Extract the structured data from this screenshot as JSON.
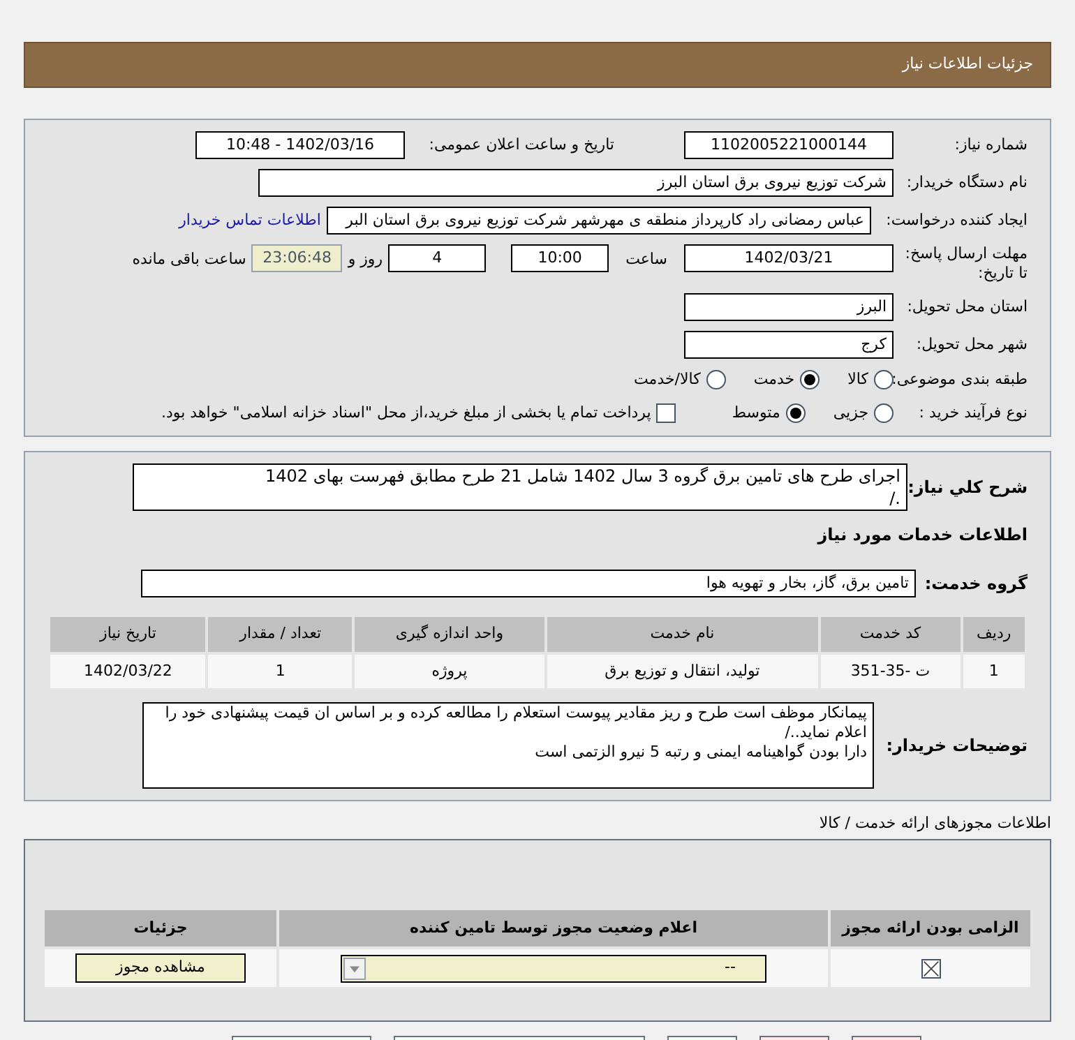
{
  "header": {
    "title": "جزئیات اطلاعات نیاز"
  },
  "need": {
    "number_label": "شماره نیاز:",
    "number": "1102005221000144",
    "announce_label": "تاریخ و ساعت اعلان عمومی:",
    "announce": "1402/03/16 - 10:48",
    "buyer_label": "نام دستگاه خریدار:",
    "buyer": "شرکت توزیع نیروی برق استان البرز",
    "creator_label": "ایجاد کننده درخواست:",
    "creator": "عباس رمضانی راد کارپرداز منطقه ی مهرشهر شرکت توزیع نیروی برق استان البر",
    "contact_link": "اطلاعات تماس خریدار",
    "deadline_label": "مهلت ارسال پاسخ: تا تاریخ:",
    "deadline_date": "1402/03/21",
    "time_label": "ساعت",
    "deadline_time": "10:00",
    "days": "4",
    "days_label": "روز و",
    "remaining": "23:06:48",
    "remaining_label": "ساعت باقی مانده",
    "province_label": "استان محل تحویل:",
    "province": "البرز",
    "city_label": "شهر محل تحویل:",
    "city": "کرج",
    "category_label": "طبقه بندی موضوعی:",
    "category_options": [
      {
        "label": "کالا",
        "selected": false
      },
      {
        "label": "خدمت",
        "selected": true
      },
      {
        "label": "کالا/خدمت",
        "selected": false
      }
    ],
    "process_label": "نوع فرآیند خرید :",
    "process_options": [
      {
        "label": "جزیی",
        "selected": false
      },
      {
        "label": "متوسط",
        "selected": true
      }
    ],
    "treasury": {
      "label": "پرداخت تمام یا بخشی از مبلغ خرید،از محل \"اسناد خزانه اسلامی\" خواهد بود.",
      "checked": false
    }
  },
  "details": {
    "summary_label": "شرح کلي نیاز:",
    "summary_lines": [
      "اجرای طرح های تامین برق گروه 3 سال 1402 شامل 21 طرح مطابق فهرست بهای 1402",
      "./"
    ],
    "services_title": "اطلاعات خدمات مورد نیاز",
    "group_label": "گروه خدمت:",
    "group": "تامین برق، گاز، بخار و تهویه هوا",
    "table": {
      "columns": [
        "ردیف",
        "کد خدمت",
        "نام خدمت",
        "واحد اندازه گیری",
        "تعداد / مقدار",
        "تاریخ نیاز"
      ],
      "rows": [
        [
          "1",
          "ت -35-351",
          "تولید، انتقال و توزیع برق",
          "پروژه",
          "1",
          "1402/03/22"
        ]
      ]
    },
    "notes_label": "توضیحات خریدار:",
    "notes_lines": [
      "پیمانکار موظف است طرح و ریز مقادیر پیوست استعلام را مطالعه کرده و بر اساس ان قیمت پیشنهادی خود را اعلام نماید../",
      "دارا بودن گواهینامه ایمنی و رتبه 5 نیرو الزتمی است"
    ]
  },
  "licenses": {
    "title": "اطلاعات مجوزهای ارائه خدمت / کالا",
    "columns": [
      "الزامی بودن ارائه مجوز",
      "اعلام وضعیت مجوز توسط تامین کننده",
      "جزئیات"
    ],
    "rows": [
      {
        "required": true,
        "status": "--",
        "button": "مشاهده مجوز"
      }
    ]
  },
  "bottom_buttons": [
    {
      "color": "#ffe8e8"
    },
    {
      "color": "#ffe8e8"
    },
    {
      "color": "#f4fff4"
    },
    {
      "color": "#f4fff4"
    },
    {
      "color": "#f4fff4"
    }
  ]
}
